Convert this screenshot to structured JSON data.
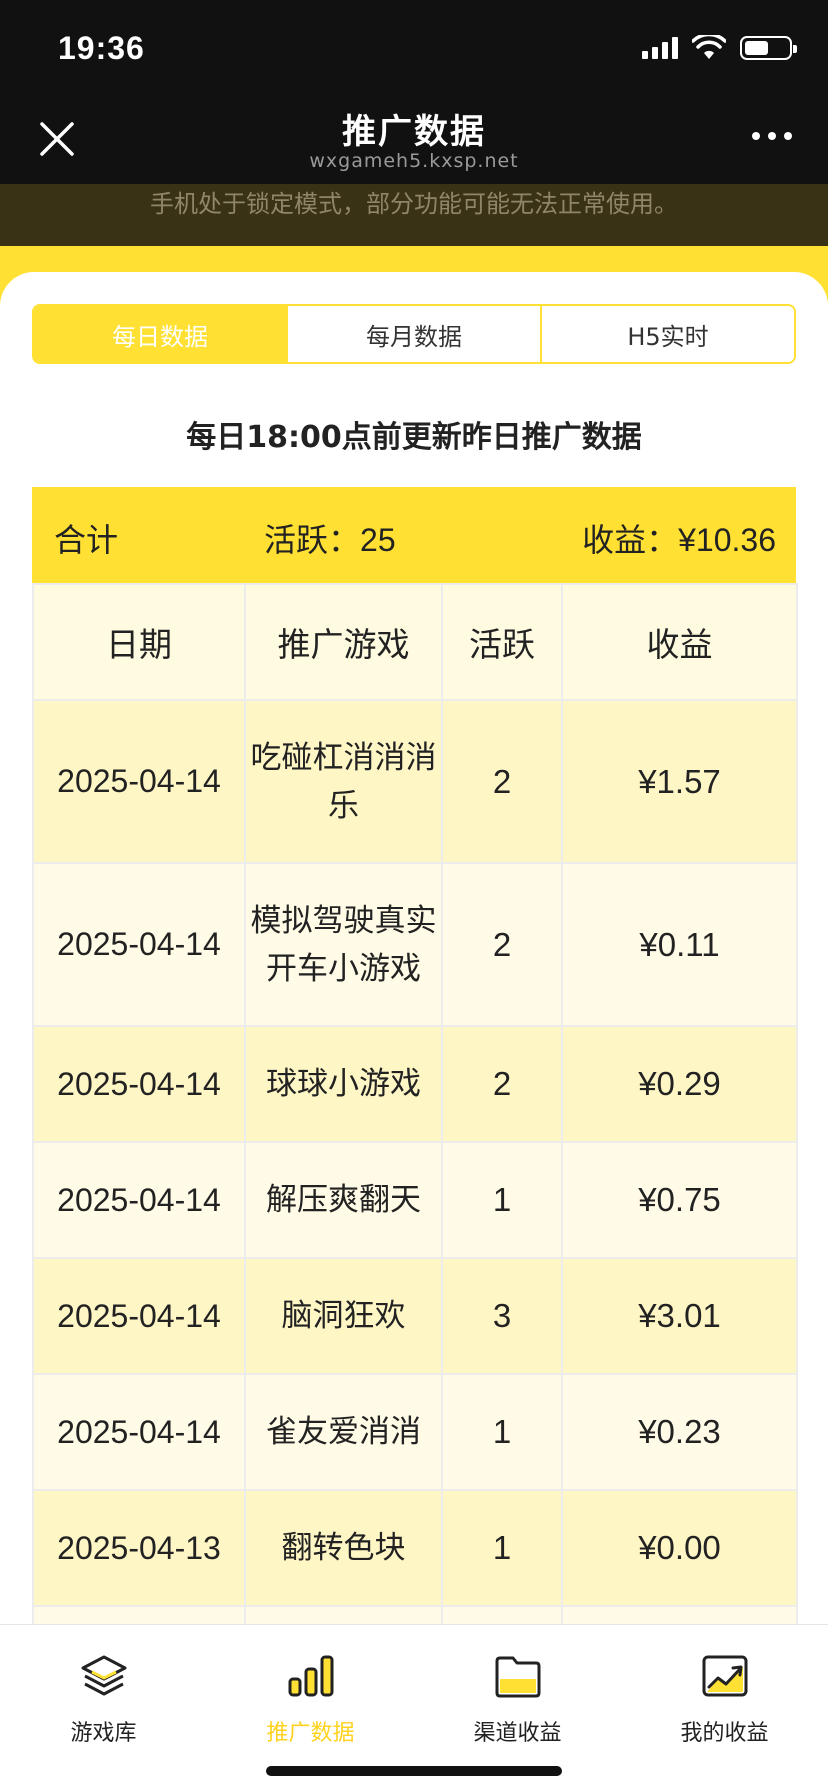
{
  "status": {
    "time": "19:36"
  },
  "nav": {
    "title": "推广数据",
    "subtitle": "wxgameh5.kxsp.net"
  },
  "notice": "手机处于锁定模式，部分功能可能无法正常使用。",
  "tabs": [
    {
      "label": "每日数据",
      "active": true
    },
    {
      "label": "每月数据",
      "active": false
    },
    {
      "label": "H5实时",
      "active": false
    }
  ],
  "caption": "每日18:00点前更新昨日推广数据",
  "summary": {
    "total_label": "合计",
    "active_label": "活跃：",
    "active_value": "25",
    "income_label": "收益：",
    "income_value": "¥10.36"
  },
  "table": {
    "headers": [
      "日期",
      "推广游戏",
      "活跃",
      "收益"
    ],
    "rows": [
      {
        "date": "2025-04-14",
        "game_line1": "吃碰杠消消消",
        "game_line2": "乐",
        "active": "2",
        "income": "¥1.57"
      },
      {
        "date": "2025-04-14",
        "game_line1": "模拟驾驶真实",
        "game_line2": "开车小游戏",
        "active": "2",
        "income": "¥0.11"
      },
      {
        "date": "2025-04-14",
        "game_line1": "球球小游戏",
        "game_line2": "",
        "active": "2",
        "income": "¥0.29"
      },
      {
        "date": "2025-04-14",
        "game_line1": "解压爽翻天",
        "game_line2": "",
        "active": "1",
        "income": "¥0.75"
      },
      {
        "date": "2025-04-14",
        "game_line1": "脑洞狂欢",
        "game_line2": "",
        "active": "3",
        "income": "¥3.01"
      },
      {
        "date": "2025-04-14",
        "game_line1": "雀友爱消消",
        "game_line2": "",
        "active": "1",
        "income": "¥0.23"
      },
      {
        "date": "2025-04-13",
        "game_line1": "翻转色块",
        "game_line2": "",
        "active": "1",
        "income": "¥0.00"
      }
    ]
  },
  "tabbar": [
    {
      "label": "游戏库",
      "icon": "layers-icon",
      "active": false
    },
    {
      "label": "推广数据",
      "icon": "bar-chart-icon",
      "active": true
    },
    {
      "label": "渠道收益",
      "icon": "folder-icon",
      "active": false
    },
    {
      "label": "我的收益",
      "icon": "trend-chart-icon",
      "active": false
    }
  ],
  "colors": {
    "accent": "#ffe033",
    "dark": "#111111"
  }
}
